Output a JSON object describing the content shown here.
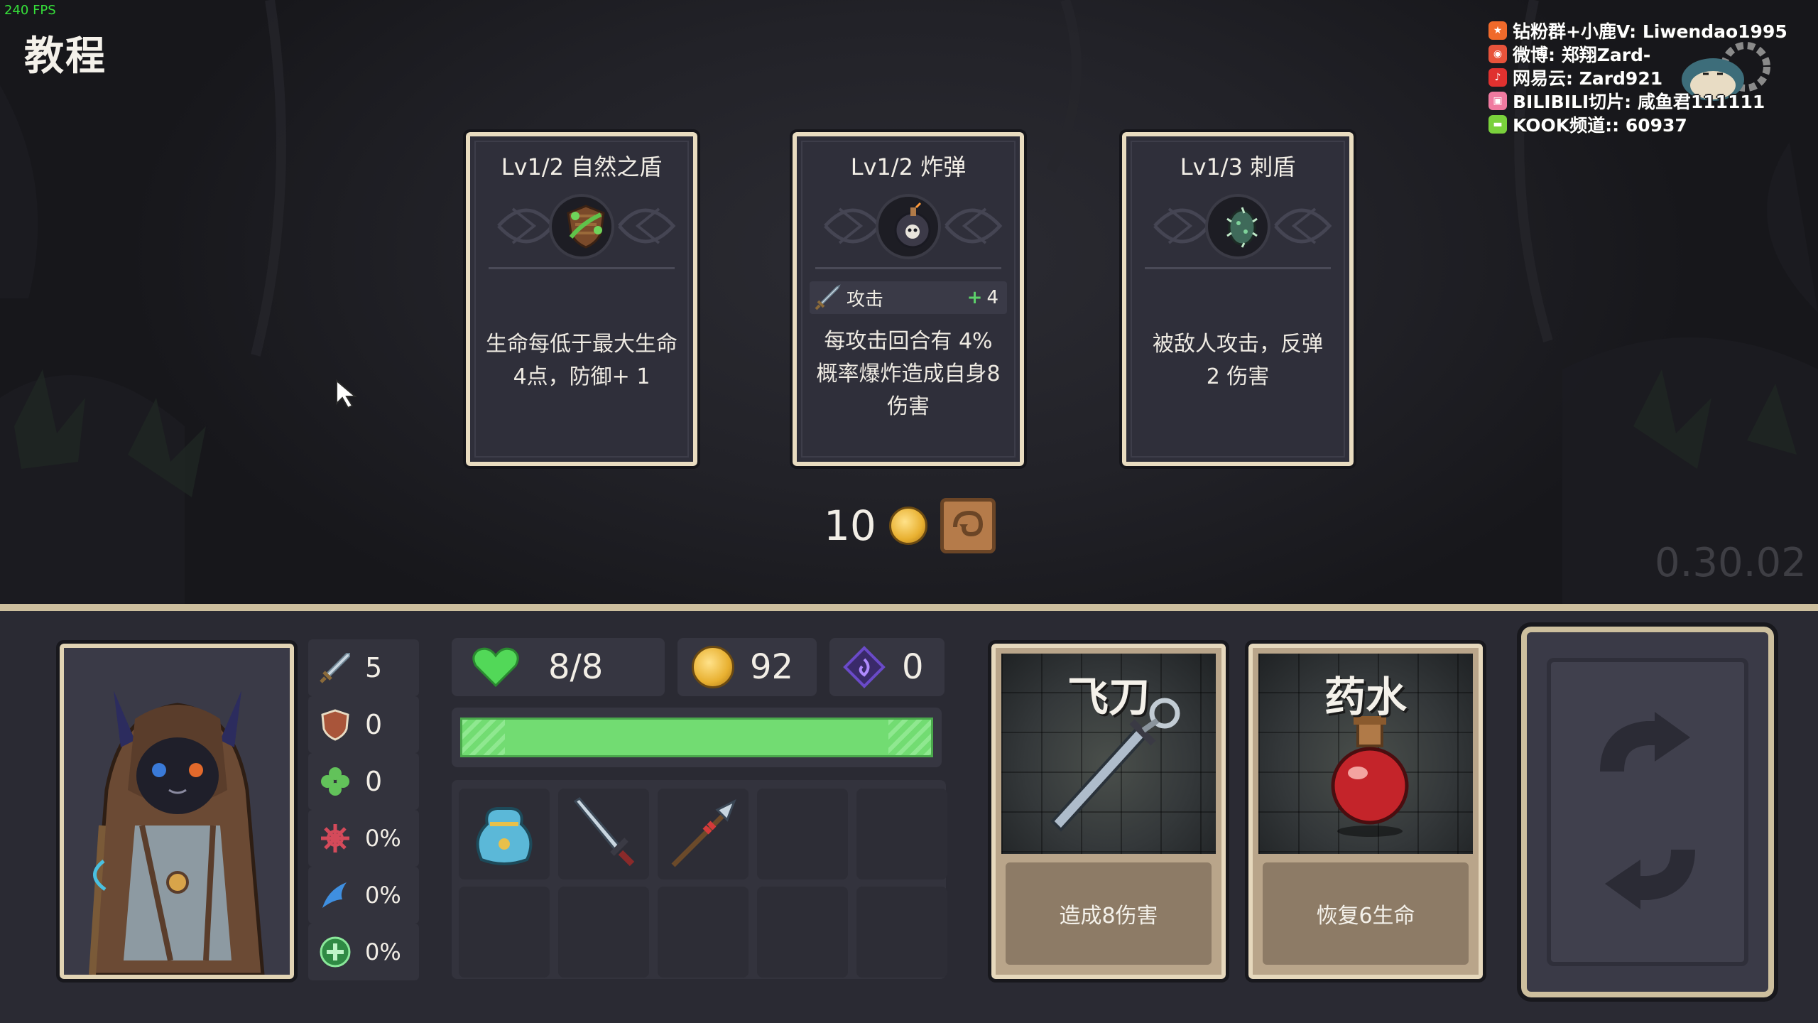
{
  "hud_overlay": {
    "fps": "240 FPS",
    "version": "0.30.02"
  },
  "screen": {
    "title": "教程"
  },
  "streamer": {
    "lines": [
      {
        "icon": "kook-fan-icon",
        "text": "钻粉群+小鹿V: Liwendao1995",
        "color": "#f06a2b"
      },
      {
        "icon": "weibo-icon",
        "text": "微博: 郑翔Zard-",
        "color": "#e8533b"
      },
      {
        "icon": "netease-music-icon",
        "text": "网易云: Zard921",
        "color": "#e0312f"
      },
      {
        "icon": "bilibili-icon",
        "text": "BILIBILI切片: 咸鱼君111111",
        "color": "#f07aa0"
      },
      {
        "icon": "kook-icon",
        "text": "KOOK频道:: 60937",
        "color": "#7ad13c"
      }
    ]
  },
  "upgrade_cards": [
    {
      "title": "Lv1/2 自然之盾",
      "icon": "nature-shield-icon",
      "desc_lines": [
        "生命每低于最大生命",
        "4点，防御+ 1"
      ]
    },
    {
      "title": "Lv1/2 炸弹",
      "icon": "bomb-icon",
      "stat": {
        "icon": "sword-icon",
        "label": "攻击",
        "plus": "+",
        "value": "4"
      },
      "desc_lines": [
        "每攻击回合有 4%",
        "概率爆炸造成自身8",
        "伤害"
      ]
    },
    {
      "title": "Lv1/3 刺盾",
      "icon": "spike-shield-icon",
      "desc_lines": [
        "被敌人攻击，反弹",
        "2 伤害"
      ]
    }
  ],
  "reroll": {
    "cost": "10",
    "icon": "reroll-icon"
  },
  "player": {
    "portrait": "cat-mage-portrait",
    "stats": [
      {
        "icon": "sword-icon",
        "value": "5",
        "color": "#8fb3c9"
      },
      {
        "icon": "shield-icon",
        "value": "0",
        "color": "#a9553a"
      },
      {
        "icon": "clover-icon",
        "value": "0",
        "color": "#62c25a"
      },
      {
        "icon": "crit-icon",
        "value": "0%",
        "color": "#d44a5a"
      },
      {
        "icon": "dodge-icon",
        "value": "0%",
        "color": "#3f8fe0"
      },
      {
        "icon": "heal-icon",
        "value": "0%",
        "color": "#4ac064"
      }
    ],
    "hp": "8/8",
    "hp_fraction": 1.0,
    "gold": "92",
    "gems": "0"
  },
  "inventory": [
    {
      "icon": "pouch-icon"
    },
    {
      "icon": "dagger-icon"
    },
    {
      "icon": "spear-icon"
    }
  ],
  "action_cards": [
    {
      "title": "飞刀",
      "art": "flying-knife-art",
      "desc": "造成8伤害"
    },
    {
      "title": "药水",
      "art": "potion-art",
      "desc": "恢复6生命"
    }
  ],
  "deck": {
    "icon": "cycle-icon"
  }
}
